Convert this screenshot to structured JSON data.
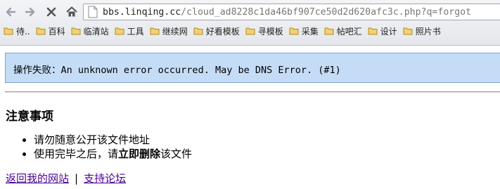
{
  "browser": {
    "url_host": "bbs.linqing.cc",
    "url_path": "/cloud_ad8228c1da46bf907ce50d2d620afc3c.php?q=forgot",
    "bookmarks": [
      "待..",
      "百科",
      "临清站",
      "工具",
      "继续网",
      "好看模板",
      "寻模板",
      "采集",
      "帖吧汇",
      "设计",
      "照片书"
    ]
  },
  "error": {
    "prefix": "操作失败：",
    "text": "An unknown error occurred. May be DNS Error. (#1)"
  },
  "notice": {
    "title": "注意事项",
    "item1": "请勿随意公开该文件地址",
    "item2_before": "使用完毕之后，请",
    "item2_bold": "立即删除",
    "item2_after": "该文件"
  },
  "links": {
    "back": "返回我的网站",
    "separator": "|",
    "support": "支持论坛"
  },
  "colors": {
    "error_bg": "#c5dcf6",
    "error_border": "#7aa2d6",
    "link": "#4b0094"
  }
}
